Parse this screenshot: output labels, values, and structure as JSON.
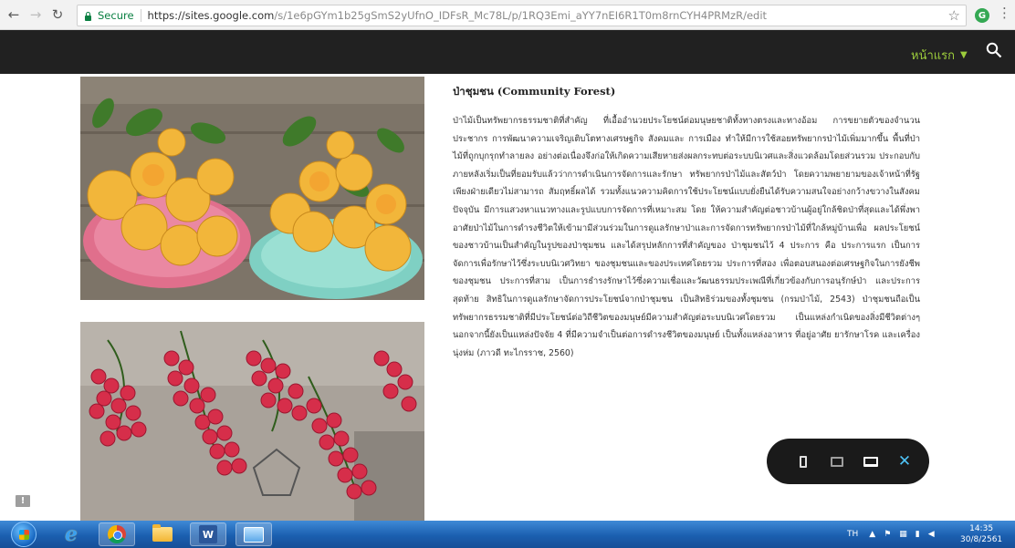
{
  "browser": {
    "secure_label": "Secure",
    "url_host": "https://sites.google.com",
    "url_path": "/s/1e6pGYm1b25gSmS2yUfnO_IDFsR_Mc78L/p/1RQ3Emi_aYY7nEI6R1T0m8rnCYH4PRMzR/edit"
  },
  "site": {
    "nav_home": "หน้าแรก"
  },
  "article": {
    "title": "ป่าชุมชน (Community Forest)",
    "body": "ป่าไม้เป็นทรัพยากรธรรมชาติที่สำคัญ ที่เอื้ออำนวยประโยชน์ต่อมนุษยชาติทั้งทางตรงและทางอ้อม การขยายตัวของจำนวนประชากร การพัฒนาความเจริญเติบโตทางเศรษฐกิจ สังคมและ การเมือง ทำให้มีการใช้สอยทรัพยากรป่าไม้เพิ่มมากขึ้น พื้นที่ป่าไม้ที่ถูกบุกรุกทำลายลง อย่างต่อเนื่องจึงก่อให้เกิดความเสียหายส่งผลกระทบต่อระบบนิเวศและสิ่งแวดล้อมโดยส่วนรวม ประกอบกับภายหลังเริ่มเป็นที่ยอมรับแล้วว่าการดำเนินการจัดการและรักษา ทรัพยากรป่าไม้และสัตว์ป่า โดยความพยายามของเจ้าหน้าที่รัฐเพียงฝ่ายเดียวไม่สามารถ สัมฤทธิ์ผลได้ รวมทั้งแนวความคิดการใช้ประโยชน์แบบยั่งยืนได้รับความสนใจอย่างกว้างขวางในสังคมปัจจุบัน มีการแสวงหาแนวทางและรูปแบบการจัดการที่เหมาะสม โดย ให้ความสำคัญต่อชาวบ้านผู้อยู่ใกล้ชิดป่าที่สุดและได้พึ่งพาอาศัยป่าไม้ในการดำรงชีวิตให้เข้ามามีส่วนร่วมในการดูแลรักษาป่าและการจัดการทรัพยากรป่าไม้ที่ใกล้หมู่บ้านเพื่อ ผลประโยชน์ของชาวบ้านเป็นสำคัญในรูปของป่าชุมชน และได้สรุปหลักการที่สำคัญของ ป่าชุมชนไว้ 4 ประการ คือ ประการแรก เป็นการจัดการเพื่อรักษาไว้ซึ่งระบบนิเวศวิทยา ของชุมชนและของประเทศโดยรวม ประการที่สอง เพื่อตอบสนองต่อเศรษฐกิจในการยังชีพ ของชุมชน ประการที่สาม เป็นการธำรงรักษาไว้ซึ่งความเชื่อและวัฒนธรรมประเพณีที่เกี่ยวข้องกับการอนุรักษ์ป่า และประการสุดท้าย สิทธิในการดูแลรักษาจัดการประโยชน์จากป่าชุมชน เป็นสิทธิร่วมของทั้งชุมชน (กรมป่าไม้, 2543) ป่าชุมชนถือเป็นทรัพยากรธรรมชาติที่มีประโยชน์ต่อวิถีชีวิตของมนุษย์มีความสำคัญต่อระบบนิเวศโดยรวม เป็นแหล่งกำเนิดของสิ่งมีชีวิตต่างๆ นอกจากนี้ยังเป็นแหล่งปัจจัย 4 ที่มีความจำเป็นต่อการดำรงชีวิตของมนุษย์ เป็นทั้งแหล่งอาหาร ที่อยู่อาศัย ยารักษาโรค และเครื่องนุ่งห่ม (ภาวดี ทะไกรราช, 2560)"
  },
  "icons": {
    "back": "back-arrow-icon",
    "forward": "forward-arrow-icon",
    "reload": "reload-icon",
    "star": "star-icon",
    "search": "search-icon",
    "close": "close-icon"
  },
  "colors": {
    "header_bg": "#212121",
    "nav_accent": "#9ccc3c",
    "secure_green": "#0b8043",
    "taskbar": "#1b5fb0"
  },
  "taskbar": {
    "language": "TH",
    "time": "14:35",
    "date": "30/8/2561"
  }
}
